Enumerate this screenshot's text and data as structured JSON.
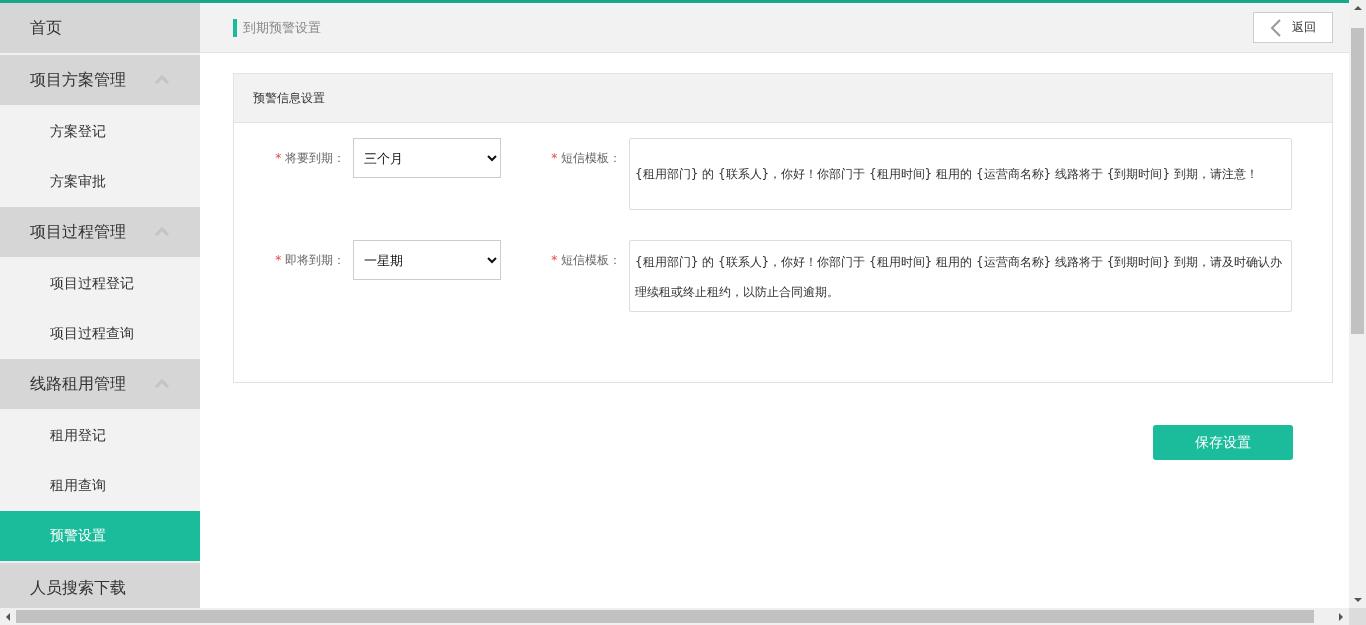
{
  "sidebar": {
    "items": [
      {
        "label": "首页",
        "selected": false
      },
      {
        "label": "项目方案管理",
        "expanded": true,
        "children": [
          {
            "label": "方案登记",
            "selected": false
          },
          {
            "label": "方案审批",
            "selected": false
          }
        ]
      },
      {
        "label": "项目过程管理",
        "expanded": true,
        "children": [
          {
            "label": "项目过程登记",
            "selected": false
          },
          {
            "label": "项目过程查询",
            "selected": false
          }
        ]
      },
      {
        "label": "线路租用管理",
        "expanded": true,
        "children": [
          {
            "label": "租用登记",
            "selected": false
          },
          {
            "label": "租用查询",
            "selected": false
          },
          {
            "label": "预警设置",
            "selected": true
          }
        ]
      },
      {
        "label": "人员搜索下载",
        "selected": false
      }
    ]
  },
  "header": {
    "breadcrumb": "到期预警设置",
    "back_button": "返回"
  },
  "panel": {
    "title": "预警信息设置",
    "rows": [
      {
        "label": "将要到期：",
        "required_mark": "*",
        "value": "三个月",
        "template_label": "短信模板：",
        "template_required_mark": "*",
        "template": "{租用部门} 的 {联系人}，你好！你部门于 {租用时间} 租用的 {运营商名称} 线路将于 {到期时间} 到期，请注意！"
      },
      {
        "label": "即将到期：",
        "required_mark": "*",
        "value": "一星期",
        "template_label": "短信模板：",
        "template_required_mark": "*",
        "template": "{租用部门} 的 {联系人}，你好！你部门于 {租用时间} 租用的 {运营商名称} 线路将于 {到期时间} 到期，请及时确认办理续租或终止租约，以防止合同逾期。"
      }
    ]
  },
  "save_button": "保存设置"
}
